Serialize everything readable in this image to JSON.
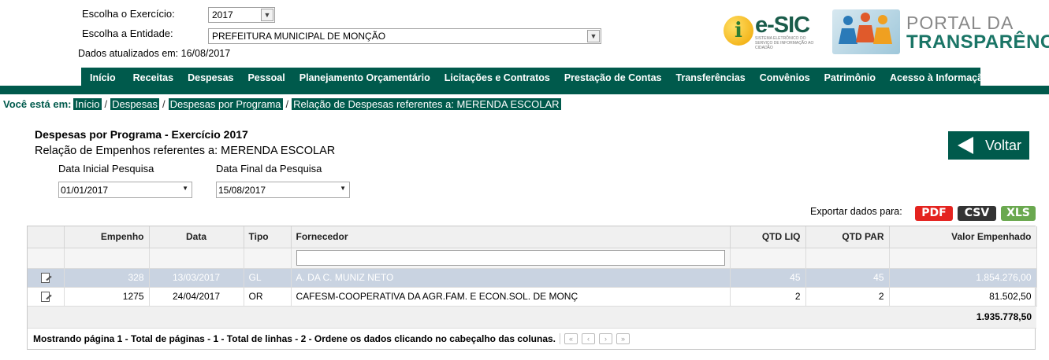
{
  "header": {
    "exercicio_label": "Escolha o Exercício:",
    "exercicio_value": "2017",
    "entidade_label": "Escolha a Entidade:",
    "entidade_value": "PREFEITURA MUNICIPAL DE MONÇÃO",
    "updated": "Dados atualizados em: 16/08/2017"
  },
  "logos": {
    "esic_text": "e-SIC",
    "esic_sub": "SISTEMA ELETRÔNICO DO SERVIÇO DE INFORMAÇÃO AO CIDADÃO",
    "portal_line1": "PORTAL DA",
    "portal_line2": "TRANSPARÊNCIA"
  },
  "menu": [
    "Início",
    "Receitas",
    "Despesas",
    "Pessoal",
    "Planejamento Orçamentário",
    "Licitações e Contratos",
    "Prestação de Contas",
    "Transferências",
    "Convênios",
    "Patrimônio",
    "Acesso à Informação"
  ],
  "breadcrumb": {
    "lead": "Você está em:",
    "items": [
      "Início",
      "Despesas",
      "Despesas por Programa",
      "Relação de Despesas referentes a: MERENDA ESCOLAR"
    ]
  },
  "page": {
    "title": "Despesas por Programa - Exercício 2017",
    "subtitle": "Relação de Empenhos referentes a: MERENDA ESCOLAR",
    "data_inicial_label": "Data Inicial Pesquisa",
    "data_inicial_value": "01/01/2017",
    "data_final_label": "Data Final da Pesquisa",
    "data_final_value": "15/08/2017",
    "voltar_label": "Voltar",
    "export_label": "Exportar dados para:",
    "export_buttons": [
      "PDF",
      "CSV",
      "XLS"
    ]
  },
  "colors": {
    "brand": "#005a4c",
    "pdf": "#e4231f",
    "csv": "#333333",
    "xls": "#6aa84f",
    "selected_row": "#c9d3e1"
  },
  "table": {
    "headers": [
      "Empenho",
      "Data",
      "Tipo",
      "Fornecedor",
      "QTD LIQ",
      "QTD PAR",
      "Valor Empenhado"
    ],
    "rows": [
      [
        "328",
        "13/03/2017",
        "GL",
        "A. DA C. MUNIZ NETO",
        "45",
        "45",
        "1.854.276,00"
      ],
      [
        "1275",
        "24/04/2017",
        "OR",
        "CAFESM-COOPERATIVA DA AGR.FAM. E ECON.SOL. DE MONÇ",
        "2",
        "2",
        "81.502,50"
      ]
    ],
    "total": "1.935.778,50",
    "pager_text": "Mostrando página 1 - Total de páginas - 1 - Total de linhas - 2 - Ordene os dados clicando no cabeçalho das colunas.",
    "pager_buttons": [
      "«",
      "‹",
      "›",
      "»"
    ]
  }
}
